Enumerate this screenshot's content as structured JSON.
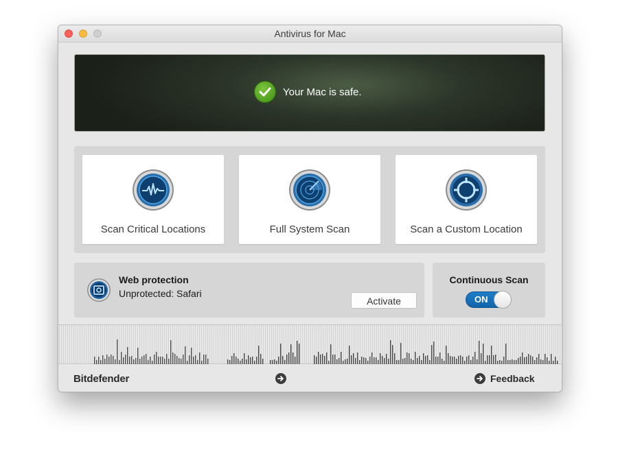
{
  "window": {
    "title": "Antivirus for Mac"
  },
  "status": {
    "message": "Your Mac is safe."
  },
  "scans": [
    {
      "label": "Scan Critical Locations",
      "icon": "pulse-scan-icon"
    },
    {
      "label": "Full System Scan",
      "icon": "radar-scan-icon"
    },
    {
      "label": "Scan a Custom Location",
      "icon": "target-scan-icon"
    }
  ],
  "web_protection": {
    "title": "Web protection",
    "status": "Unprotected: Safari",
    "button_label": "Activate"
  },
  "continuous_scan": {
    "title": "Continuous Scan",
    "toggle_label": "ON",
    "enabled": true
  },
  "footer": {
    "brand": "Bitdefender",
    "feedback_label": "Feedback"
  },
  "colors": {
    "accent": "#1a72bd",
    "safe_green": "#4ca320",
    "panel": "#d6d6d6"
  }
}
